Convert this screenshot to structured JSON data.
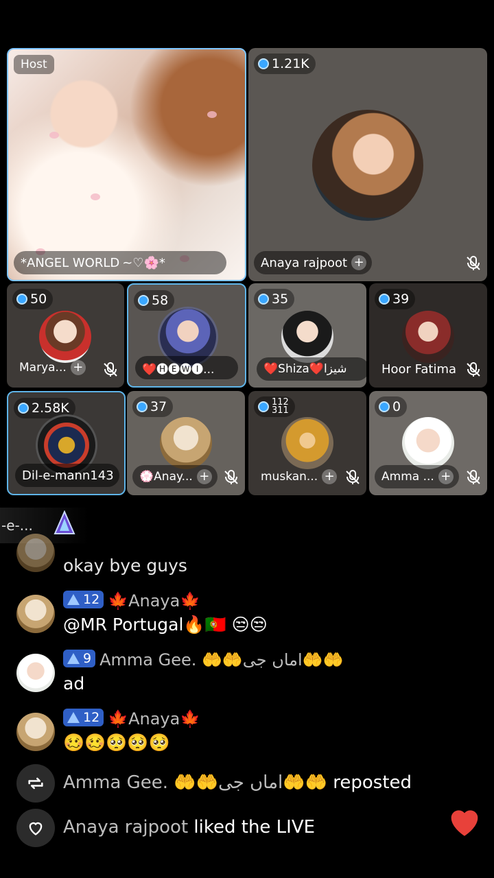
{
  "guests": [
    {
      "id": "host",
      "label": "Host",
      "name": "*ANGEL WORLD",
      "name_suffix": "~♡🌸*"
    },
    {
      "id": "g1",
      "count": "1.21K",
      "name": "Anaya rajpoot"
    },
    {
      "id": "g2",
      "count": "50",
      "name": "Marya..."
    },
    {
      "id": "g3",
      "count": "58",
      "name": "❤️🅗🅔🅦🅘..."
    },
    {
      "id": "g4",
      "count": "35",
      "name": "❤️Shiza❤️شیزا"
    },
    {
      "id": "g5",
      "count": "39",
      "name": "Hoor Fatima"
    },
    {
      "id": "g6",
      "count": "2.58K",
      "name": "Dil-e-mann143"
    },
    {
      "id": "g7",
      "count": "37",
      "name": "💮Anay..."
    },
    {
      "id": "g8",
      "count": "112",
      "count2": "311",
      "name": "muskan..."
    },
    {
      "id": "g9",
      "count": "0",
      "name": "Amma ..."
    }
  ],
  "banner": {
    "text": "-e-..."
  },
  "chat": [
    {
      "name": "",
      "level": "",
      "text": "okay bye guys"
    },
    {
      "name": "🍁Anaya🍁",
      "level": "12",
      "text": "@MR Portugal🔥🇵🇹 😒😒"
    },
    {
      "name": "Amma Gee. 🤲🤲اماں جی🤲🤲",
      "level": "9",
      "text": "ad"
    },
    {
      "name": "🍁Anaya🍁",
      "level": "12",
      "text": "🥴🥴🥺🥺🥺"
    }
  ],
  "events": [
    {
      "icon": "repost-icon",
      "user": "Amma Gee. 🤲🤲اماں جی🤲🤲",
      "action": "reposted"
    },
    {
      "icon": "heart-outline-icon",
      "user": "Anaya rajpoot",
      "action": "liked the LIVE"
    }
  ],
  "colors": {
    "accent": "#3aa7ff",
    "level_badge": "#2f5fc6",
    "like": "#e8413a"
  }
}
